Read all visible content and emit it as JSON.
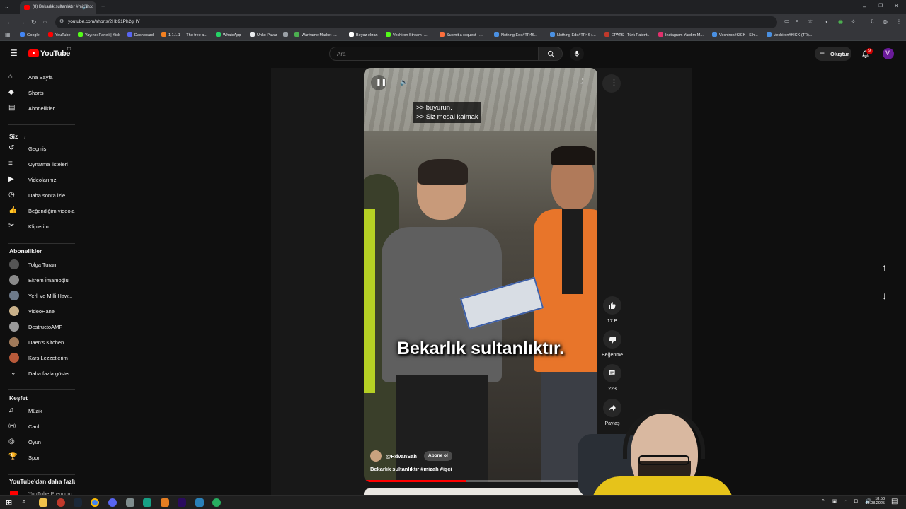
{
  "browser": {
    "tab_title": "(8) Bekarlık sultanlıktır #mizah",
    "url": "youtube.com/shorts/2Hb91Ph2gHY",
    "bookmarks": [
      {
        "label": "Google",
        "color": "#4285f4"
      },
      {
        "label": "YouTube",
        "color": "#ff0000"
      },
      {
        "label": "Yayıncı Paneli | Kick",
        "color": "#53fc18"
      },
      {
        "label": "Dashboard",
        "color": "#5865f2"
      },
      {
        "label": "1.1.1.1 — The free a...",
        "color": "#f38020"
      },
      {
        "label": "WhatsApp",
        "color": "#25d366"
      },
      {
        "label": "Unko Pazar",
        "color": "#e8eaed"
      },
      {
        "label": "",
        "color": "#9aa0a6"
      },
      {
        "label": "Warframe Market |...",
        "color": "#4caf50"
      },
      {
        "label": "Beyaz ekran",
        "color": "#ffffff"
      },
      {
        "label": "Vechiron Stream -...",
        "color": "#53fc18"
      },
      {
        "label": "Submit a request –...",
        "color": "#ff6f3c"
      },
      {
        "label": "Nothing Ede#TR46...",
        "color": "#4a90e2"
      },
      {
        "label": "Nothing Ede#TR46 (...",
        "color": "#4a90e2"
      },
      {
        "label": "EPATS - Türk Patent...",
        "color": "#c0392b"
      },
      {
        "label": "Instagram Yardım M...",
        "color": "#e1306c"
      },
      {
        "label": "Vechiron#KICK - Sih...",
        "color": "#4a90e2"
      },
      {
        "label": "Vechiron#KICK (TR)...",
        "color": "#4a90e2"
      }
    ]
  },
  "header": {
    "logo_text": "YouTube",
    "logo_region": "TR",
    "search_placeholder": "Ara",
    "create_label": "Oluştur",
    "notification_count": "9"
  },
  "sidebar": {
    "main": [
      {
        "label": "Ana Sayfa",
        "icon": "home-icon"
      },
      {
        "label": "Shorts",
        "icon": "shorts-icon"
      },
      {
        "label": "Abonelikler",
        "icon": "subscriptions-icon",
        "dot": true
      }
    ],
    "you_header": "Siz",
    "you": [
      {
        "label": "Geçmiş",
        "icon": "history-icon"
      },
      {
        "label": "Oynatma listeleri",
        "icon": "playlist-icon"
      },
      {
        "label": "Videolarınız",
        "icon": "your-videos-icon"
      },
      {
        "label": "Daha sonra izle",
        "icon": "watch-later-icon"
      },
      {
        "label": "Beğendiğim videolar",
        "icon": "liked-icon"
      },
      {
        "label": "Kliplerim",
        "icon": "clips-icon"
      }
    ],
    "subs_header": "Abonelikler",
    "subs": [
      {
        "label": "Tolga Turan",
        "color": "#555555",
        "dot": true
      },
      {
        "label": "Ekrem İmamoğlu",
        "color": "#8a8a8a",
        "dot": true
      },
      {
        "label": "Yerli ve Milli Haw...",
        "color": "#6d7a8a",
        "dot": true
      },
      {
        "label": "VideoHane",
        "color": "#c9b18a",
        "dot": false
      },
      {
        "label": "DestructoAMF",
        "color": "#9a9a9a",
        "dot": false
      },
      {
        "label": "Daen's Kitchen",
        "color": "#a07a5a",
        "dot": true
      },
      {
        "label": "Kars Lezzetlerim",
        "color": "#b85a3a",
        "dot": true
      }
    ],
    "show_more": "Daha fazla göster",
    "explore_header": "Keşfet",
    "explore": [
      {
        "label": "Müzik",
        "icon": "music-icon"
      },
      {
        "label": "Canlı",
        "icon": "live-icon"
      },
      {
        "label": "Oyun",
        "icon": "gaming-icon"
      },
      {
        "label": "Spor",
        "icon": "sports-icon"
      }
    ],
    "more_header": "YouTube'dan daha fazla...",
    "premium_label": "YouTube Premium"
  },
  "video": {
    "caption_lines": [
      ">> buyurun.",
      ">> Siz mesai kalmak"
    ],
    "subtitle": "Bekarlık sultanlıktır.",
    "channel": "@RdvanSah",
    "subscribe_label": "Abone ol",
    "title": "Bekarlık sultanlıktır #mizah #işçi"
  },
  "actions": {
    "likes": "17 B",
    "dislike_label": "Beğenme",
    "comments": "223",
    "share_label": "Paylaş"
  },
  "taskbar": {
    "time": "18:50",
    "date": "13.08.2025"
  }
}
